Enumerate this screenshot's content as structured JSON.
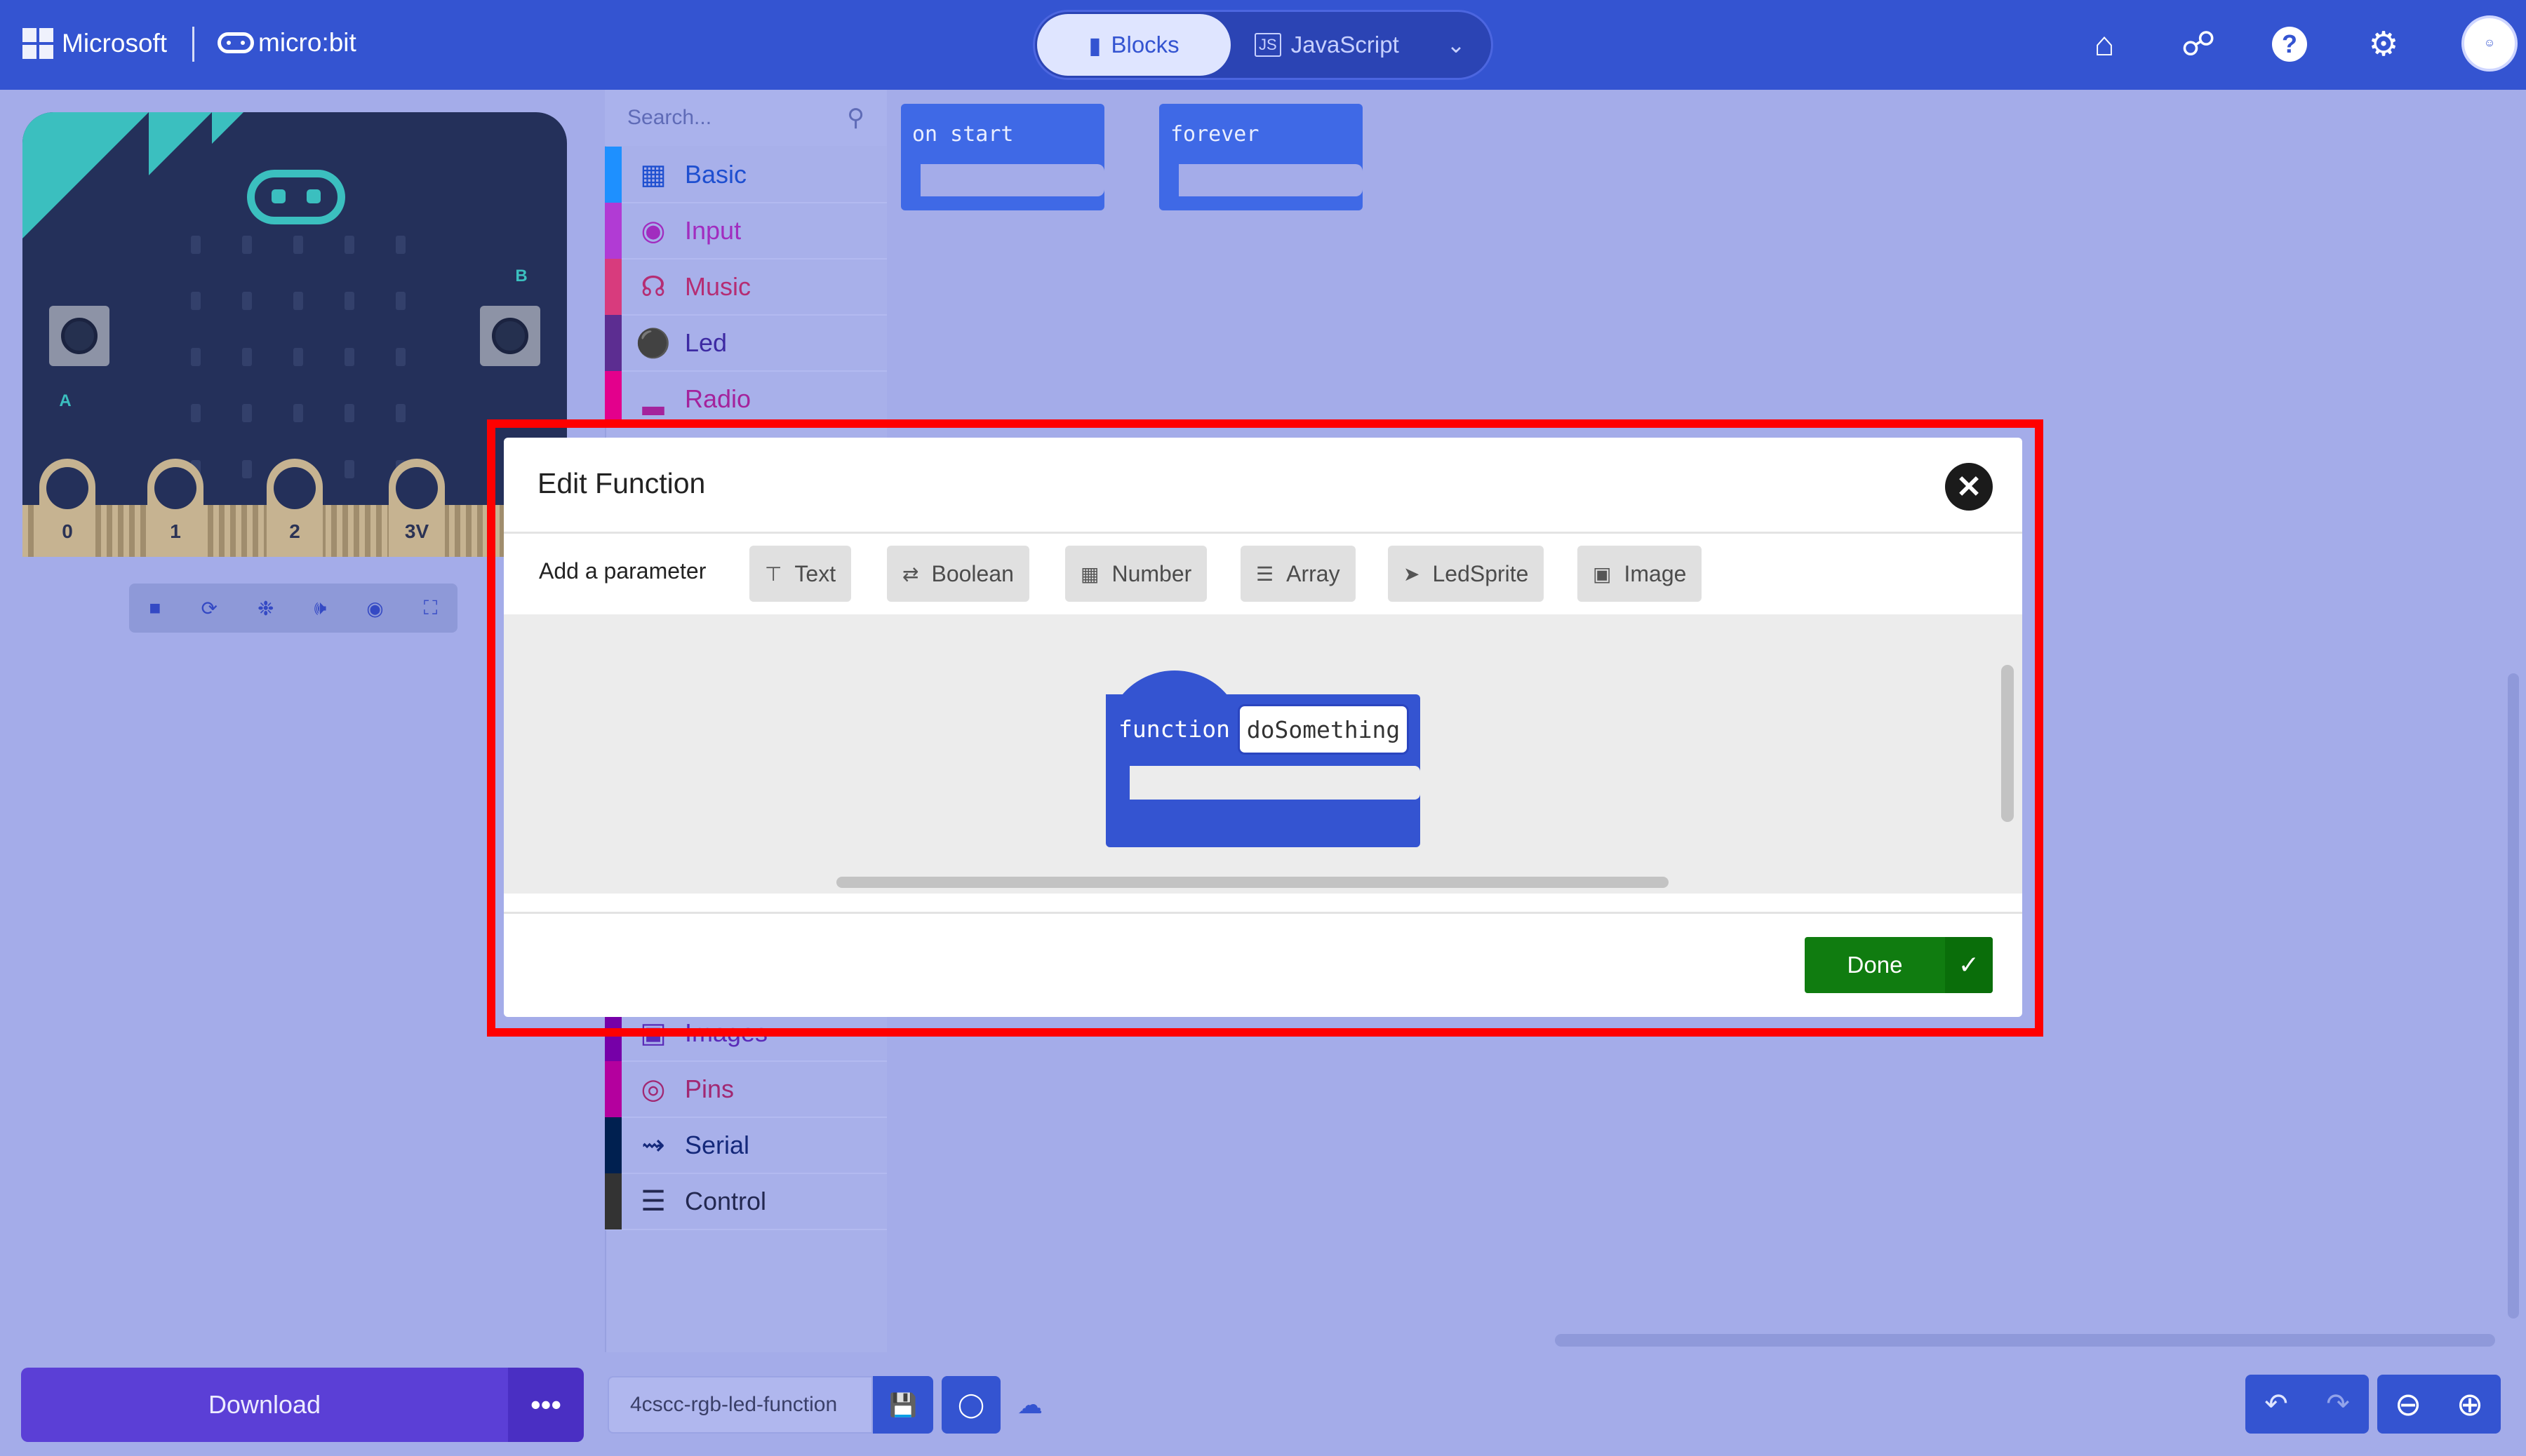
{
  "header": {
    "brand": "Microsoft",
    "product": "micro:bit",
    "editor_toggle": {
      "blocks": "Blocks",
      "javascript": "JavaScript"
    },
    "icons": [
      "home-icon",
      "share-icon",
      "help-icon",
      "settings-icon",
      "avatar"
    ]
  },
  "simulator": {
    "button_a": "A",
    "button_b": "B",
    "pins": [
      "0",
      "1",
      "2",
      "3V"
    ]
  },
  "toolbox": {
    "search_placeholder": "Search...",
    "categories": [
      {
        "label": "Basic",
        "color": "#1e90ff",
        "text_color": "#1e4fd0"
      },
      {
        "label": "Input",
        "color": "#b13bd4",
        "text_color": "#a12dbf"
      },
      {
        "label": "Music",
        "color": "#d83b7d",
        "text_color": "#b52d73"
      },
      {
        "label": "Led",
        "color": "#5c2d91",
        "text_color": "#3d2aa3"
      },
      {
        "label": "Radio",
        "color": "#e3008c",
        "text_color": "#a4239c"
      },
      {
        "label": "Images",
        "color": "#7600a8",
        "text_color": "#5a2bb8"
      },
      {
        "label": "Pins",
        "color": "#b4009e",
        "text_color": "#a12872"
      },
      {
        "label": "Serial",
        "color": "#002050",
        "text_color": "#14287a"
      },
      {
        "label": "Control",
        "color": "#333333",
        "text_color": "#232850"
      }
    ]
  },
  "workspace": {
    "blocks": [
      "on start",
      "forever"
    ]
  },
  "dialog": {
    "title": "Edit Function",
    "add_parameter_label": "Add a parameter",
    "parameter_types": [
      "Text",
      "Boolean",
      "Number",
      "Array",
      "LedSprite",
      "Image"
    ],
    "function_keyword": "function",
    "function_name": "doSomething",
    "done_label": "Done"
  },
  "footer": {
    "download_label": "Download",
    "more_label": "•••",
    "project_name": "4cscc-rgb-led-function"
  },
  "colors": {
    "header_bg": "#3454d1",
    "workspace_bg": "#a4ace9",
    "block_blue": "#3f69e6",
    "done_green": "#107c10",
    "highlight_red": "#ff0000"
  }
}
